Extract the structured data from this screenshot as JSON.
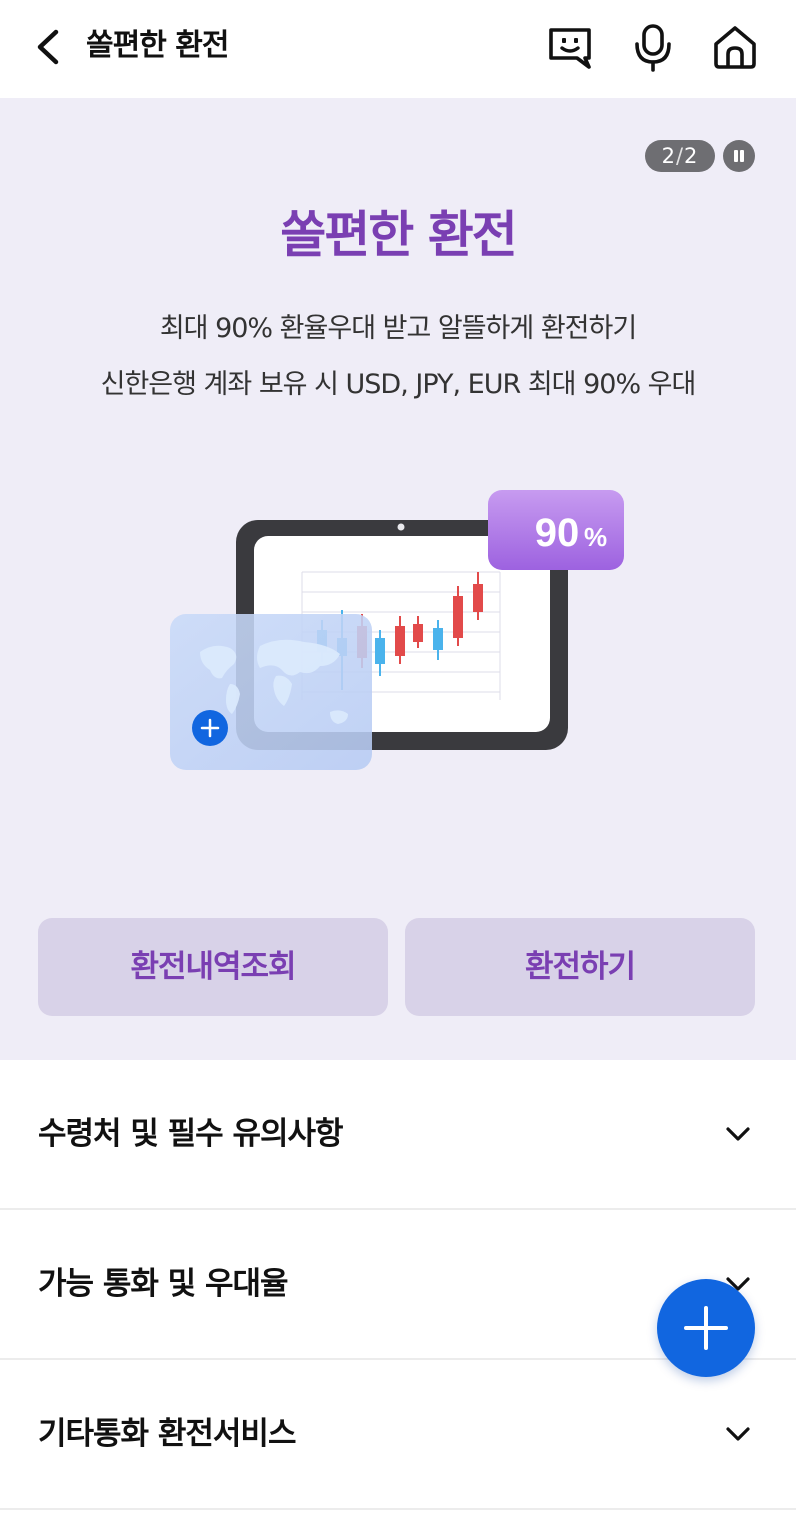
{
  "header": {
    "title": "쏠편한 환전",
    "icons": [
      "back-icon",
      "chatbot-icon",
      "microphone-icon",
      "home-icon"
    ]
  },
  "banner": {
    "pager_current": "2",
    "pager_total": "2",
    "title": "쏠편한 환전",
    "description_line1": "최대 90% 환율우대 받고 알뜰하게 환전하기",
    "description_line2": "신한은행 계좌 보유 시 USD, JPY, EUR 최대 90% 우대",
    "badge_value": "90",
    "badge_unit": "%",
    "buttons": {
      "history": "환전내역조회",
      "exchange": "환전하기"
    }
  },
  "accordion": [
    {
      "label": "수령처 및 필수 유의사항"
    },
    {
      "label": "가능 통화 및 우대율"
    },
    {
      "label": "기타통화 환전서비스"
    }
  ],
  "colors": {
    "accent_purple": "#7a3fb2",
    "banner_bg": "#efedf7",
    "button_bg": "#d8d2e8",
    "fab_blue": "#1166e0"
  }
}
